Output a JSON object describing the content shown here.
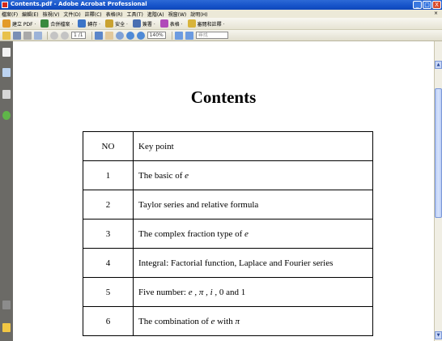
{
  "window": {
    "title": "Contents.pdf - Adobe Acrobat Professional",
    "controls": [
      "_",
      "▢",
      "X"
    ]
  },
  "menubar": {
    "items": [
      "檔案(F)",
      "編輯(E)",
      "檢視(V)",
      "文件(D)",
      "註釋(C)",
      "表格(R)",
      "工具(T)",
      "進階(A)",
      "視窗(W)",
      "說明(H)"
    ],
    "close": "×"
  },
  "toolbar1": {
    "items": [
      {
        "label": "建立 PDF ·",
        "icon": "create-pdf-icon",
        "color": "#e39b2a"
      },
      {
        "label": "合併檔案 ·",
        "icon": "combine-files-icon",
        "color": "#3a8a3e"
      },
      {
        "label": "轉存 ·",
        "icon": "export-icon",
        "color": "#3b74c7"
      },
      {
        "label": "安全 ·",
        "icon": "lock-icon",
        "color": "#c9a231"
      },
      {
        "label": "簽署 ·",
        "icon": "pen-icon",
        "color": "#4a6fb1"
      },
      {
        "label": "表格 ·",
        "icon": "form-icon",
        "color": "#b04ab9"
      },
      {
        "label": "審閱和註釋 ·",
        "icon": "review-icon",
        "color": "#d8b43b"
      }
    ]
  },
  "toolbar2": {
    "page_indicator": "1 /1",
    "zoom": "140%",
    "search_placeholder": "尋找"
  },
  "document": {
    "title": "Contents",
    "header": {
      "no": "NO",
      "key": "Key point"
    },
    "rows": [
      {
        "no": "1",
        "text": "The basic of",
        "math": "e",
        "rest": ""
      },
      {
        "no": "2",
        "text": "Taylor series and relative formula",
        "math": "",
        "rest": ""
      },
      {
        "no": "3",
        "text": "The complex fraction type of",
        "math": "e",
        "rest": ""
      },
      {
        "no": "4",
        "text": "Integral: Factorial function, Laplace and Fourier series",
        "math": "",
        "rest": ""
      },
      {
        "no": "5",
        "text": "Five number:",
        "math": "e , π , i ,",
        "rest": " 0 and 1"
      },
      {
        "no": "6",
        "text": "The combination of",
        "math": "e",
        "rest": " with ",
        "math2": "π"
      }
    ]
  },
  "scrollbar": {
    "up": "▲",
    "down": "▼"
  }
}
